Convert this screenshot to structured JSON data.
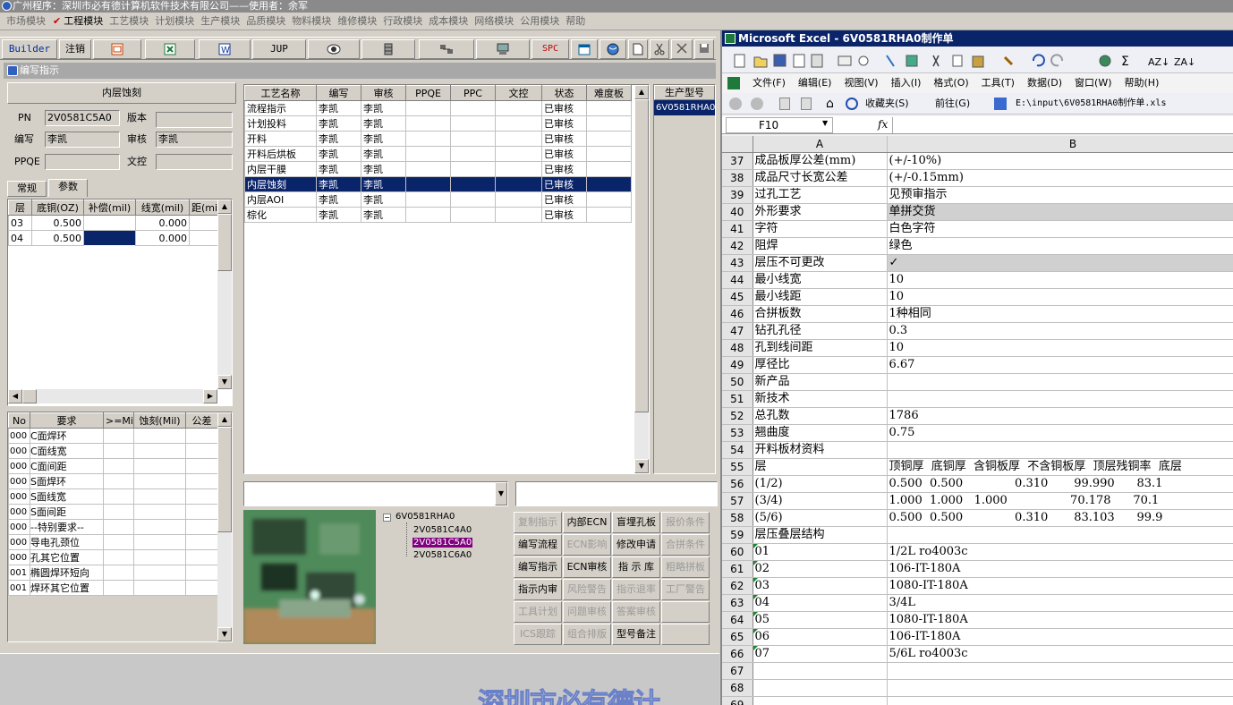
{
  "app": {
    "title": "广州程序：深圳市必有德计算机软件技术有限公司——使用者：余军",
    "menu": [
      "市场模块",
      "工程模块",
      "工艺模块",
      "计划模块",
      "生产模块",
      "品质模块",
      "物料模块",
      "维修模块",
      "行政模块",
      "成本模块",
      "网络模块",
      "公用模块",
      "帮助"
    ],
    "toolbar": {
      "builder": "Builder",
      "logout": "注销",
      "jup": "JUP",
      "spc": "SPC"
    }
  },
  "panel": {
    "title": "编写指示",
    "section_title": "内层蚀刻",
    "fields": {
      "pn_label": "PN",
      "pn_value": "2V0581C5A0",
      "version_label": "版本",
      "version_value": "",
      "writer_label": "编写",
      "writer_value": "李凯",
      "reviewer_label": "审核",
      "reviewer_value": "李凯",
      "ppqe_label": "PPQE",
      "ppqe_value": "",
      "doc_label": "文控",
      "doc_value": ""
    },
    "tabs": [
      "常规",
      "参数"
    ],
    "layers": {
      "headers": [
        "层",
        "底铜(OZ)",
        "补偿(mil)",
        "线宽(mil)",
        "距(mi"
      ],
      "rows": [
        [
          "03",
          "0.500",
          "",
          "0.000",
          ""
        ],
        [
          "04",
          "0.500",
          "",
          "0.000",
          ""
        ]
      ]
    },
    "requirements": {
      "headers": [
        "No",
        "要求",
        ">=Mil",
        "蚀刻(Mil)",
        "公差"
      ],
      "rows": [
        [
          "000",
          "C面焊环"
        ],
        [
          "000",
          "C面线宽"
        ],
        [
          "000",
          "C面间距"
        ],
        [
          "000",
          "S面焊环"
        ],
        [
          "000",
          "S面线宽"
        ],
        [
          "000",
          "S面间距"
        ],
        [
          "000",
          "--特别要求--"
        ],
        [
          "000",
          "导电孔颈位"
        ],
        [
          "000",
          "孔其它位置"
        ],
        [
          "001",
          "椭圆焊环短向"
        ],
        [
          "001",
          "焊环其它位置"
        ]
      ]
    },
    "process": {
      "headers": [
        "工艺名称",
        "编写",
        "审核",
        "PPQE",
        "PPC",
        "文控",
        "状态",
        "难度板"
      ],
      "rows": [
        [
          "流程指示",
          "李凯",
          "李凯",
          "",
          "",
          "",
          "已审核",
          ""
        ],
        [
          "计划投料",
          "李凯",
          "李凯",
          "",
          "",
          "",
          "已审核",
          ""
        ],
        [
          "开料",
          "李凯",
          "李凯",
          "",
          "",
          "",
          "已审核",
          ""
        ],
        [
          "开料后烘板",
          "李凯",
          "李凯",
          "",
          "",
          "",
          "已审核",
          ""
        ],
        [
          "内层干膜",
          "李凯",
          "李凯",
          "",
          "",
          "",
          "已审核",
          ""
        ],
        [
          "内层蚀刻",
          "李凯",
          "李凯",
          "",
          "",
          "",
          "已审核",
          ""
        ],
        [
          "内层AOI",
          "李凯",
          "李凯",
          "",
          "",
          "",
          "已审核",
          ""
        ],
        [
          "棕化",
          "李凯",
          "李凯",
          "",
          "",
          "",
          "已审核",
          ""
        ]
      ],
      "selected_index": 5
    },
    "model_list": {
      "header": "生产型号",
      "items": [
        "6V0581RHA0"
      ]
    },
    "tree": {
      "root": "6V0581RHA0",
      "children": [
        "2V0581C4A0",
        "2V0581C5A0",
        "2V0581C6A0"
      ],
      "selected_index": 1
    },
    "buttons": [
      {
        "label": "复制指示",
        "enabled": false
      },
      {
        "label": "内部ECN",
        "enabled": true
      },
      {
        "label": "盲埋孔板",
        "enabled": true
      },
      {
        "label": "报价条件",
        "enabled": false
      },
      {
        "label": "编写流程",
        "enabled": true
      },
      {
        "label": "ECN影响",
        "enabled": false
      },
      {
        "label": "修改申请",
        "enabled": true
      },
      {
        "label": "合拼条件",
        "enabled": false
      },
      {
        "label": "编写指示",
        "enabled": true
      },
      {
        "label": "ECN审核",
        "enabled": true
      },
      {
        "label": "指 示 库",
        "enabled": true
      },
      {
        "label": "粗略拼板",
        "enabled": false
      },
      {
        "label": "指示内审",
        "enabled": true
      },
      {
        "label": "风险警告",
        "enabled": false
      },
      {
        "label": "指示退率",
        "enabled": false
      },
      {
        "label": "工厂警告",
        "enabled": false
      },
      {
        "label": "工具计划",
        "enabled": false
      },
      {
        "label": "问题审核",
        "enabled": false
      },
      {
        "label": "答案审核",
        "enabled": false
      },
      {
        "label": "",
        "enabled": false
      },
      {
        "label": "ICS跟踪",
        "enabled": false
      },
      {
        "label": "组合排版",
        "enabled": false
      },
      {
        "label": "型号备注",
        "enabled": true
      },
      {
        "label": "",
        "enabled": false
      }
    ],
    "watermark": "深圳市必有德计"
  },
  "excel": {
    "title": "Microsoft Excel - 6V0581RHA0制作单",
    "menu": [
      "文件(F)",
      "编辑(E)",
      "视图(V)",
      "插入(I)",
      "格式(O)",
      "工具(T)",
      "数据(D)",
      "窗口(W)",
      "帮助(H)"
    ],
    "web": {
      "favorites": "收藏夹(S)",
      "goto": "前往(G)",
      "path": "E:\\input\\6V0581RHA0制作单.xls"
    },
    "namebox": "F10",
    "fx": "fx",
    "col_headers": [
      "A",
      "B"
    ],
    "rows": [
      {
        "n": "37",
        "a": "成品板厚公差(mm)",
        "b": "(+/-10%)"
      },
      {
        "n": "38",
        "a": "成品尺寸长宽公差",
        "b": "(+/-0.15mm)"
      },
      {
        "n": "39",
        "a": "过孔工艺",
        "b": "见预审指示"
      },
      {
        "n": "40",
        "a": "外形要求",
        "b": "单拼交货",
        "gray": true
      },
      {
        "n": "41",
        "a": "字符",
        "b": "白色字符"
      },
      {
        "n": "42",
        "a": "阻焊",
        "b": "绿色"
      },
      {
        "n": "43",
        "a": "层压不可更改",
        "b": "✓",
        "gray": true
      },
      {
        "n": "44",
        "a": "最小线宽",
        "b": "10"
      },
      {
        "n": "45",
        "a": "最小线距",
        "b": "10"
      },
      {
        "n": "46",
        "a": "合拼板数",
        "b": "1种相同"
      },
      {
        "n": "47",
        "a": "钻孔孔径",
        "b": "0.3"
      },
      {
        "n": "48",
        "a": "孔到线间距",
        "b": "10"
      },
      {
        "n": "49",
        "a": "厚径比",
        "b": "6.67"
      },
      {
        "n": "50",
        "a": "新产品",
        "b": ""
      },
      {
        "n": "51",
        "a": "新技术",
        "b": ""
      },
      {
        "n": "52",
        "a": "总孔数",
        "b": "1786"
      },
      {
        "n": "53",
        "a": "翘曲度",
        "b": "0.75"
      },
      {
        "n": "54",
        "a": "开料板材资料",
        "b": ""
      },
      {
        "n": "55",
        "a": "层",
        "b": "顶铜厚  底铜厚  含铜板厚  不含铜板厚  顶层残铜率  底层"
      },
      {
        "n": "56",
        "a": "(1/2)",
        "b": "0.500  0.500              0.310       99.990      83.1"
      },
      {
        "n": "57",
        "a": "(3/4)",
        "b": "1.000  1.000   1.000                 70.178      70.1"
      },
      {
        "n": "58",
        "a": "(5/6)",
        "b": "0.500  0.500              0.310       83.103      99.9"
      },
      {
        "n": "59",
        "a": "层压叠层结构",
        "b": ""
      },
      {
        "n": "60",
        "a": "01",
        "b": "1/2L ro4003c",
        "tri": true
      },
      {
        "n": "61",
        "a": "02",
        "b": "106-IT-180A",
        "tri": true
      },
      {
        "n": "62",
        "a": "03",
        "b": "1080-IT-180A",
        "tri": true
      },
      {
        "n": "63",
        "a": "04",
        "b": "3/4L",
        "tri": true
      },
      {
        "n": "64",
        "a": "05",
        "b": "1080-IT-180A",
        "tri": true
      },
      {
        "n": "65",
        "a": "06",
        "b": "106-IT-180A",
        "tri": true
      },
      {
        "n": "66",
        "a": "07",
        "b": "5/6L ro4003c",
        "tri": true
      },
      {
        "n": "67",
        "a": "",
        "b": ""
      },
      {
        "n": "68",
        "a": "",
        "b": ""
      },
      {
        "n": "69",
        "a": "",
        "b": ""
      }
    ]
  }
}
